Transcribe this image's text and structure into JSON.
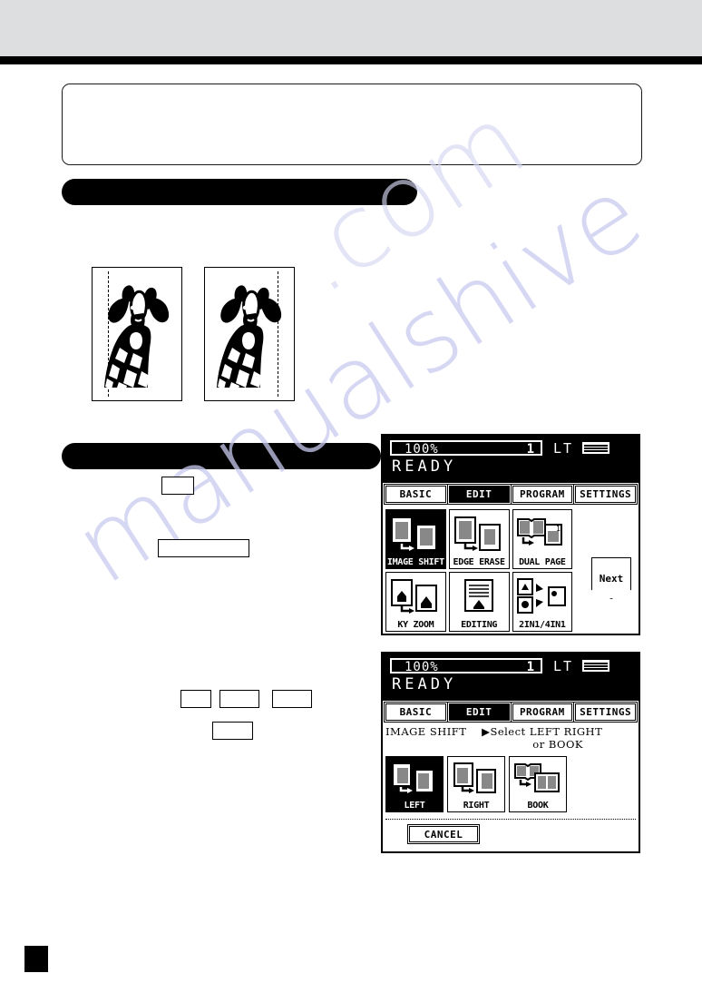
{
  "page": {
    "watermark": "manualshive",
    "watermark_2": ".com"
  },
  "sample_images": {
    "left": {
      "caption": "",
      "icon": "giraffe-photo",
      "margin_side": "left"
    },
    "right": {
      "caption": "",
      "icon": "giraffe-photo",
      "margin_side": "right"
    }
  },
  "redacted_boxes": [
    {
      "name": "redacted-box-1"
    },
    {
      "name": "redacted-box-2"
    },
    {
      "name": "redacted-box-3"
    },
    {
      "name": "redacted-box-4"
    },
    {
      "name": "redacted-box-5"
    },
    {
      "name": "redacted-box-6"
    }
  ],
  "panel_one": {
    "status": {
      "zoom": "100%",
      "copy_count": "1",
      "paper_size": "LT",
      "paper_icon": "paper-stack-icon",
      "message": "READY"
    },
    "tabs": [
      {
        "label": "BASIC",
        "selected": false
      },
      {
        "label": "EDIT",
        "selected": true
      },
      {
        "label": "PROGRAM",
        "selected": false
      },
      {
        "label": "SETTINGS",
        "selected": false
      }
    ],
    "functions": [
      {
        "label": "IMAGE SHIFT",
        "icon": "image-shift-icon",
        "selected": true
      },
      {
        "label": "EDGE ERASE",
        "icon": "edge-erase-icon",
        "selected": false
      },
      {
        "label": "DUAL  PAGE",
        "icon": "dual-page-icon",
        "selected": false
      },
      {
        "label": "KY ZOOM",
        "icon": "xy-zoom-icon",
        "selected": false
      },
      {
        "label": "EDITING",
        "icon": "editing-icon",
        "selected": false
      },
      {
        "label": "2IN1/4IN1",
        "icon": "2in1-4in1-icon",
        "selected": false
      }
    ],
    "next_label": "Next"
  },
  "panel_two": {
    "status": {
      "zoom": "100%",
      "copy_count": "1",
      "paper_size": "LT",
      "paper_icon": "paper-stack-icon",
      "message": "READY"
    },
    "tabs": [
      {
        "label": "BASIC",
        "selected": false
      },
      {
        "label": "EDIT",
        "selected": true
      },
      {
        "label": "PROGRAM",
        "selected": false
      },
      {
        "label": "SETTINGS",
        "selected": false
      }
    ],
    "instruction": {
      "mode": "IMAGE SHIFT",
      "prompt": "▶Select LEFT RIGHT",
      "prompt_line2": "or BOOK"
    },
    "options": [
      {
        "label": "LEFT",
        "icon": "shift-left-icon",
        "selected": true
      },
      {
        "label": "RIGHT",
        "icon": "shift-right-icon",
        "selected": false
      },
      {
        "label": "BOOK",
        "icon": "shift-book-icon",
        "selected": false
      }
    ],
    "cancel_label": "CANCEL"
  }
}
